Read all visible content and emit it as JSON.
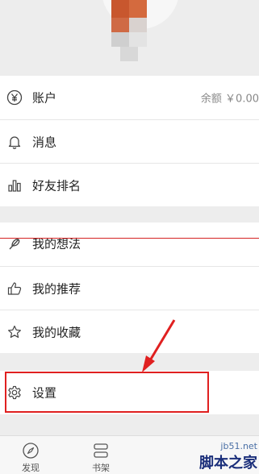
{
  "menu_group_1": [
    {
      "label": "账户",
      "value": "余额 ￥0.00",
      "icon": "yen-circle-icon"
    },
    {
      "label": "消息",
      "icon": "bell-icon"
    },
    {
      "label": "好友排名",
      "icon": "bar-chart-icon"
    }
  ],
  "menu_group_2": [
    {
      "label": "我的想法",
      "icon": "feather-icon"
    },
    {
      "label": "我的推荐",
      "icon": "thumbs-up-icon"
    },
    {
      "label": "我的收藏",
      "icon": "star-icon"
    }
  ],
  "menu_group_3": [
    {
      "label": "设置",
      "icon": "gear-icon"
    }
  ],
  "tabbar": {
    "tabs": [
      {
        "label": "发现",
        "icon": "compass-icon"
      },
      {
        "label": "书架",
        "icon": "bookshelf-icon"
      }
    ]
  },
  "watermark": {
    "url": "jb51.net",
    "text": "脚本之家"
  },
  "colors": {
    "highlight": "#e02020",
    "background": "#ededed"
  }
}
